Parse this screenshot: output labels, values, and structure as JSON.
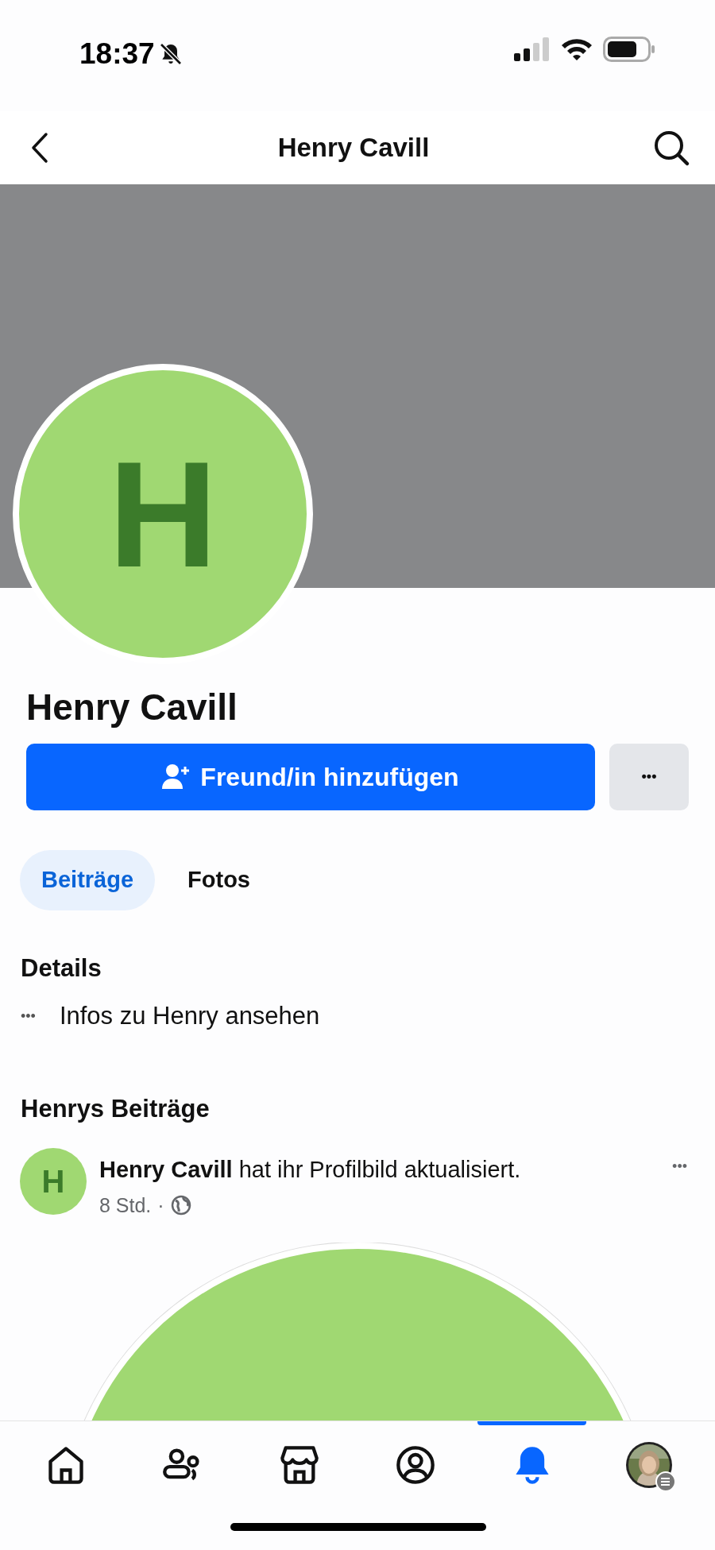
{
  "status_bar": {
    "time": "18:37",
    "silent": true
  },
  "header": {
    "title": "Henry Cavill"
  },
  "profile": {
    "initial": "H",
    "name": "Henry Cavill",
    "add_friend_button": "Freund/in hinzufügen",
    "more_button": "•••"
  },
  "tabs": [
    {
      "label": "Beiträge",
      "selected": true
    },
    {
      "label": "Fotos",
      "selected": false
    }
  ],
  "details": {
    "heading": "Details",
    "dots": "•••",
    "link": "Infos zu Henry ansehen"
  },
  "posts_section": {
    "heading": "Henrys Beiträge"
  },
  "post": {
    "initial": "H",
    "text": "**Henry Cavill** hat ihr Profilbild aktualisiert.",
    "time": "8 Std.",
    "separator": "·",
    "menu": "•••"
  },
  "bottom_nav": [
    {
      "kind": "home",
      "selected": false
    },
    {
      "kind": "friends",
      "selected": false
    },
    {
      "kind": "marketplace",
      "selected": false
    },
    {
      "kind": "profile",
      "selected": false
    },
    {
      "kind": "notifications",
      "selected": true
    },
    {
      "kind": "menu",
      "selected": false
    }
  ]
}
